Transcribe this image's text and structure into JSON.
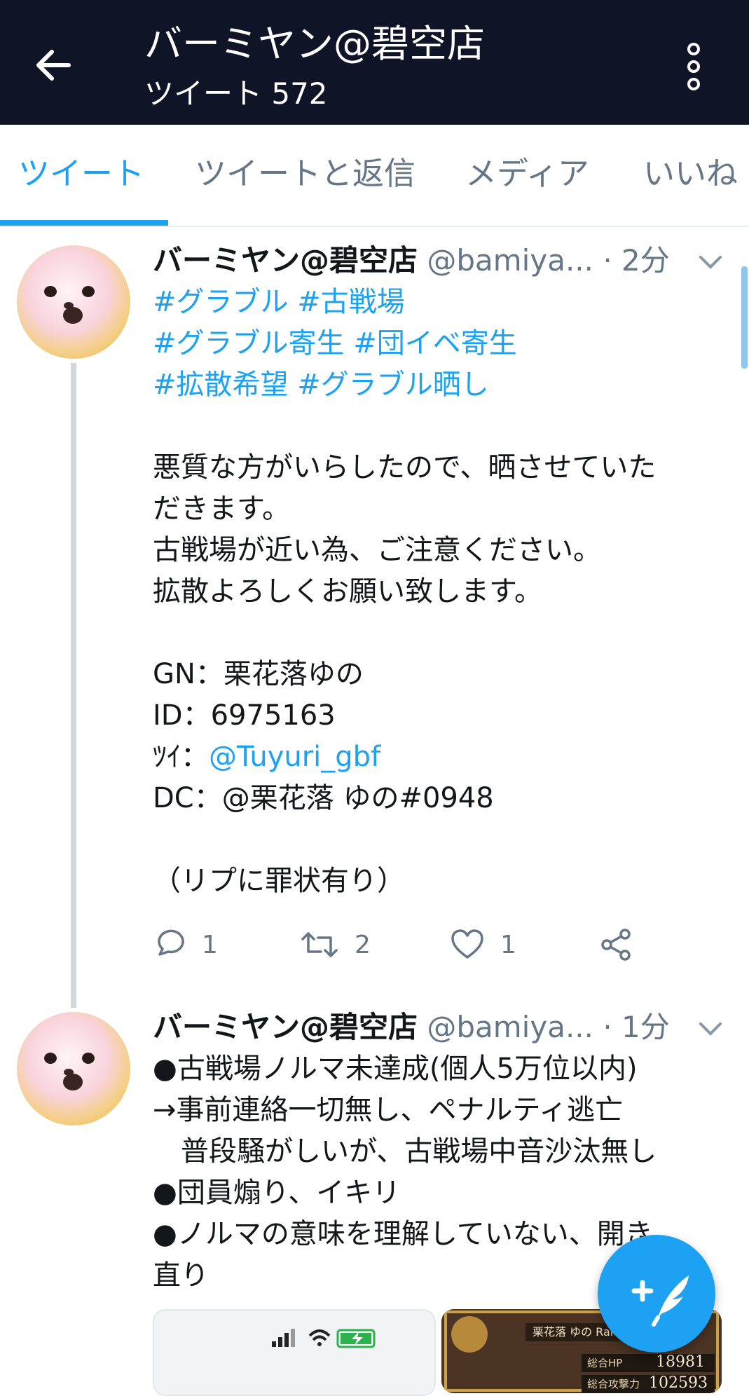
{
  "header": {
    "title": "バーミヤン@碧空店",
    "subtitle": "ツイート 572"
  },
  "tabs": [
    {
      "label": "ツイート",
      "active": true
    },
    {
      "label": "ツイートと返信"
    },
    {
      "label": "メディア"
    },
    {
      "label": "いいね"
    }
  ],
  "tweets": [
    {
      "name": "バーミヤン@碧空店",
      "handle": "@bamiya...",
      "time": "· 2分",
      "lines": [
        "#グラブル #古戦場",
        "#グラブル寄生 #団イベ寄生",
        "#拡散希望 #グラブル晒し",
        "",
        "悪質な方がいらしたので、晒させていた",
        "だきます。",
        "古戦場が近い為、ご注意ください。",
        "拡散よろしくお願い致します。",
        "",
        "GN：栗花落ゆの",
        "ID：6975163",
        "ﾂｲ：",
        "DC：@栗花落 ゆの#0948",
        "",
        "（リプに罪状有り）"
      ],
      "mention": "@Tuyuri_gbf",
      "replies": "1",
      "retweets": "2",
      "likes": "1"
    },
    {
      "name": "バーミヤン@碧空店",
      "handle": "@bamiya...",
      "time": "· 1分",
      "lines": [
        "●古戦場ノルマ未達成(個人5万位以内)",
        "→事前連絡一切無し、ペナルティ逃亡",
        "　普段騒がしいが、古戦場中音沙汰無し",
        "●団員煽り、イキリ",
        "●ノルマの意味を理解していない、開き",
        "直り"
      ]
    }
  ],
  "media_preview": {
    "game_title": "栗花落 ゆの Rank",
    "hp_label": "総合HP",
    "hp_value": "18981",
    "atk_label": "総合攻撃力",
    "atk_value": "102593"
  },
  "icons": [
    "back-arrow-icon",
    "more-vertical-icon",
    "chevron-down-icon",
    "reply-icon",
    "retweet-icon",
    "like-icon",
    "share-icon",
    "compose-tweet-icon"
  ],
  "colors": {
    "header_bg": "#0f1426",
    "accent": "#1da1f2",
    "muted": "#657786",
    "text": "#14171a"
  }
}
